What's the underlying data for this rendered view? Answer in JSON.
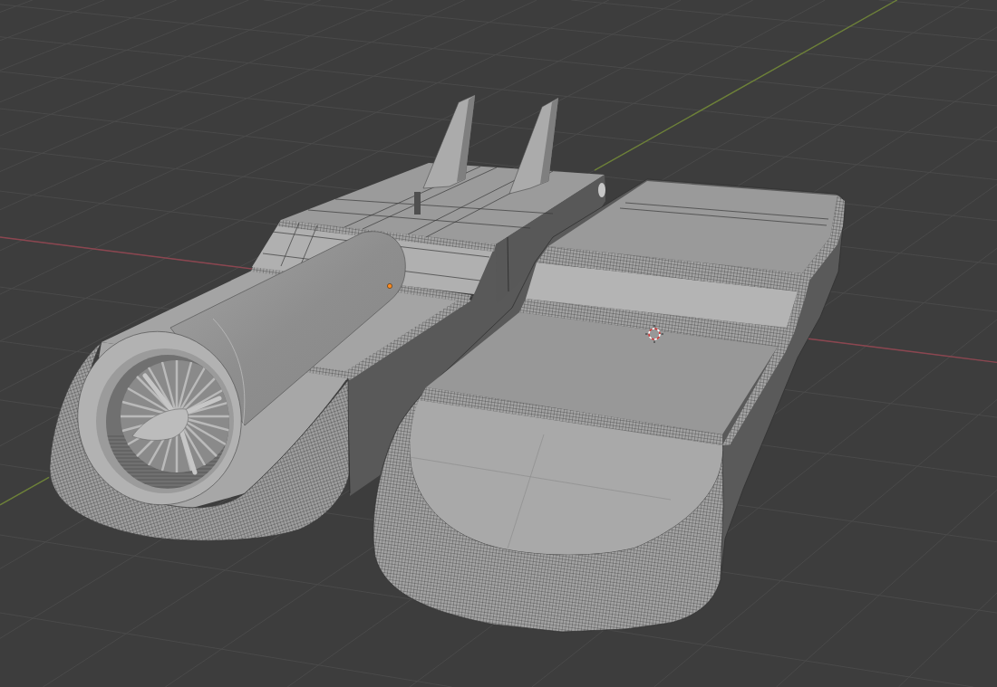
{
  "viewport": {
    "floor_grid": true,
    "x_axis": true,
    "y_axis": true,
    "cursor_3d": true,
    "object_origin": true
  }
}
